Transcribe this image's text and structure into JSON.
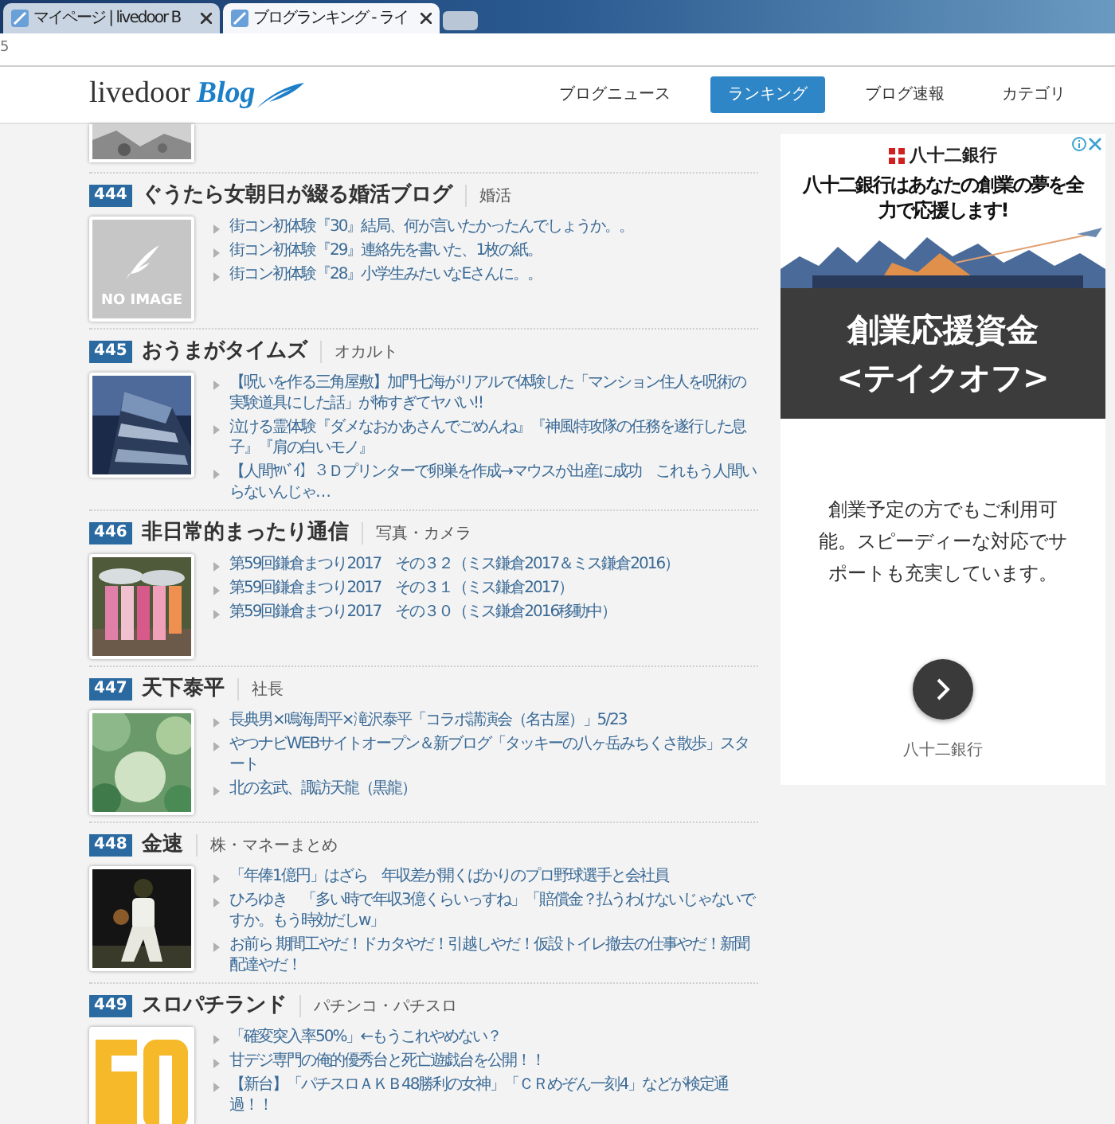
{
  "browser": {
    "tabs": [
      {
        "title": "マイページ | livedoor B",
        "selected": false
      },
      {
        "title": "ブログランキング - ライ",
        "selected": true
      }
    ],
    "address": "5"
  },
  "header": {
    "logo": {
      "brand": "livedoor",
      "product": "Blog"
    },
    "nav": [
      {
        "label": "ブログニュース",
        "selected": false
      },
      {
        "label": "ランキング",
        "selected": true
      },
      {
        "label": "ブログ速報",
        "selected": false
      },
      {
        "label": "カテゴリ",
        "selected": false
      }
    ]
  },
  "ranking": [
    {
      "rank": "444",
      "title": "ぐうたら女朝日が綴る婚活ブログ",
      "category": "婚活",
      "thumb": {
        "kind": "noimage",
        "label": "NO IMAGE"
      },
      "posts": [
        "街コン初体験『30』結局、何が言いたかったんでしょうか。。",
        "街コン初体験『29』連絡先を書いた、1枚の紙。",
        "街コン初体験『28』小学生みたいなEさんに。。"
      ]
    },
    {
      "rank": "445",
      "title": "おうまがタイムズ",
      "category": "オカルト",
      "thumb": {
        "kind": "building"
      },
      "posts": [
        "【呪いを作る三角屋敷】加門七海がリアルで体験した「マンション住人を呪術の実験道具にした話」が怖すぎてヤバい!!",
        "泣ける霊体験『ダメなおかあさんでごめんね』『神風特攻隊の任務を遂行した息子』『肩の白いモノ』",
        "【人間ﾔﾊﾞｲ】３Ｄプリンターで卵巣を作成→マウスが出産に成功　これもう人間いらないんじゃ…"
      ]
    },
    {
      "rank": "446",
      "title": "非日常的まったり通信",
      "category": "写真・カメラ",
      "thumb": {
        "kind": "people"
      },
      "posts": [
        "第59回鎌倉まつり2017　その３２（ミス鎌倉2017＆ミス鎌倉2016）",
        "第59回鎌倉まつり2017　その３１（ミス鎌倉2017）",
        "第59回鎌倉まつり2017　その３０（ミス鎌倉2016移動中）"
      ]
    },
    {
      "rank": "447",
      "title": "天下泰平",
      "category": "社長",
      "thumb": {
        "kind": "green"
      },
      "posts": [
        "長典男×鳴海周平×滝沢泰平「コラボ講演会（名古屋）」5/23",
        "やつナビWEBサイトオープン＆新ブログ「タッキーの八ヶ岳みちくさ散歩」スタート",
        "北の玄武、諏訪天龍（黒龍）"
      ]
    },
    {
      "rank": "448",
      "title": "金速",
      "category": "株・マネーまとめ",
      "thumb": {
        "kind": "player"
      },
      "posts": [
        "「年俸1億円」はざら　年収差が開くばかりのプロ野球選手と会社員",
        "ひろゆき　「多い時で年収3億くらいっすね」「賠償金？払うわけないじゃないですか。もう時効だしw」",
        "お前ら 期間工やだ！ドカタやだ！引越しやだ！仮設トイレ撤去の仕事やだ！新聞配達やだ！"
      ]
    },
    {
      "rank": "449",
      "title": "スロパチランド",
      "category": "パチンコ・パチスロ",
      "thumb": {
        "kind": "yellow"
      },
      "posts": [
        "「確変突入率50%」←もうこれやめない？",
        "甘デジ専門の俺的優秀台と死亡遊戯台を公開！！",
        "【新台】「パチスロＡＫＢ48勝利の女神」「ＣＲめぞん一刻4」などが検定通過！！"
      ]
    }
  ],
  "ad": {
    "bank": "八十二銀行",
    "headline": "八十二銀行はあなたの創業の夢を全力で応援します!",
    "product": [
      "創業応援資金",
      "<テイクオフ>"
    ],
    "body": "創業予定の方でもご利用可能。スピーディーな対応でサポートも充実しています。",
    "advertiser": "八十二銀行"
  }
}
